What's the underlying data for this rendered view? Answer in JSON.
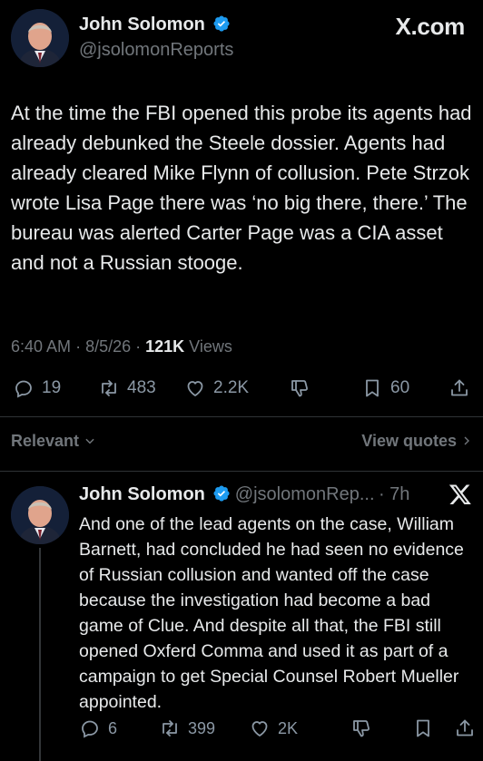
{
  "main_tweet": {
    "author_name": "John Solomon",
    "author_handle": "@jsolomonReports",
    "site": "X.com",
    "text": "At the time the FBI opened this probe its agents had already debunked the Steele dossier. Agents had already cleared Mike Flynn of collusion. Pete Strzok wrote Lisa Page there was ‘no big there, there.’ The bureau was alerted Carter Page was a CIA asset and not a Russian stooge.",
    "time": "6:40 AM",
    "date": "8/5/26",
    "views_count": "121K",
    "views_label": "Views",
    "replies": "19",
    "reposts": "483",
    "likes": "2.2K",
    "bookmarks": "60"
  },
  "filters": {
    "relevant_label": "Relevant",
    "view_quotes_label": "View quotes"
  },
  "reply_tweet": {
    "author_name": "John Solomon",
    "author_handle": "@jsolomonRep...",
    "time_ago": "· 7h",
    "text": "And one of the lead agents on the case, William Barnett, had concluded he had seen no evidence of Russian collusion and wanted off the case because the investigation had become a bad game of Clue. And despite all that, the FBI still opened Oxferd Comma and used it as part of a campaign to get Special Counsel Robert Mueller appointed.",
    "replies": "6",
    "reposts": "399",
    "likes": "2K"
  },
  "colors": {
    "background": "#000000",
    "text_primary": "#e7e9ea",
    "text_secondary": "#71767b",
    "verified_blue": "#1d9bf0"
  }
}
